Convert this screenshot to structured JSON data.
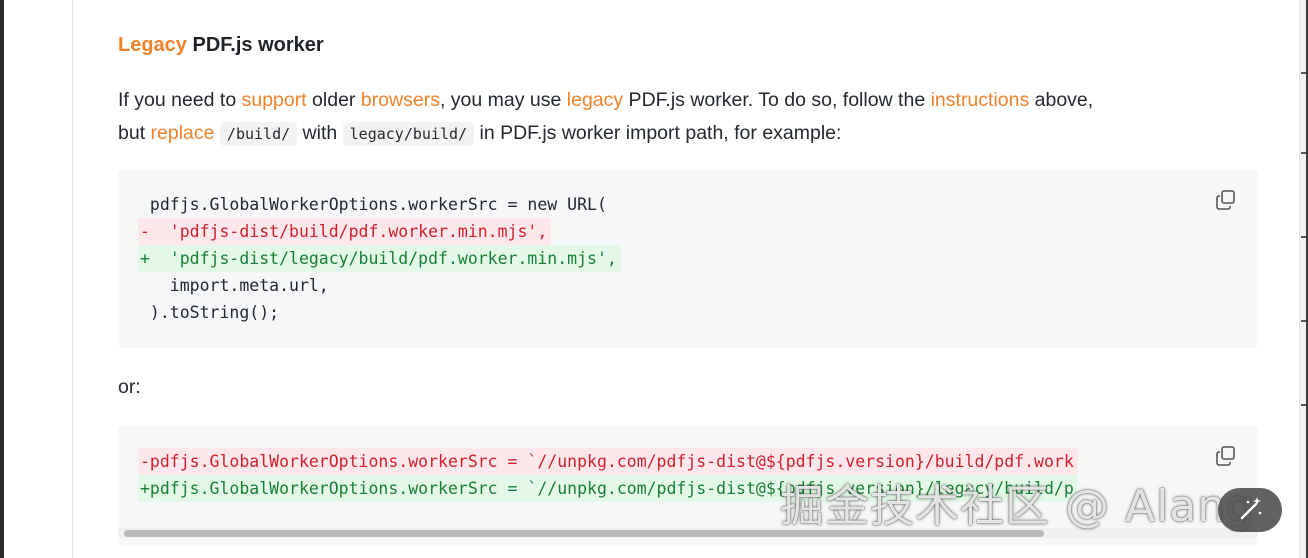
{
  "heading": {
    "accent": "Legacy",
    "rest": " PDF.js worker"
  },
  "paragraph": {
    "l1_a": "If you need to ",
    "l1_link1": "support",
    "l1_b": " older ",
    "l1_link2": "browsers",
    "l1_c": ", you may use ",
    "l1_link3": "legacy",
    "l1_d": " PDF.js worker. To do so, follow the ",
    "l1_link4": "instructions",
    "l1_e": " above,",
    "l2_a": "but ",
    "l2_link1": "replace",
    "l2_code1": "/build/",
    "l2_b": " with ",
    "l2_code2": "legacy/build/",
    "l2_c": " in PDF.js worker import path, for example:"
  },
  "code_block_1": {
    "lines": [
      " pdfjs.GlobalWorkerOptions.workerSrc = new URL(",
      "-  'pdfjs-dist/build/pdf.worker.min.mjs',",
      "+  'pdfjs-dist/legacy/build/pdf.worker.min.mjs',",
      "   import.meta.url,",
      " ).toString();"
    ]
  },
  "or_label": "or:",
  "code_block_2": {
    "lines": [
      "-pdfjs.GlobalWorkerOptions.workerSrc = `//unpkg.com/pdfjs-dist@${pdfjs.version}/build/pdf.work",
      "+pdfjs.GlobalWorkerOptions.workerSrc = `//unpkg.com/pdfjs-dist@${pdfjs.version}/legacy/build/p"
    ]
  },
  "watermark": "掘金技术社区 @ Alang",
  "icons": {
    "copy": "copy-icon",
    "magic": "magic-wand-icon"
  },
  "colors": {
    "accent": "#f0822b",
    "deletion": "#cf222e",
    "insertion": "#1a7f37"
  }
}
